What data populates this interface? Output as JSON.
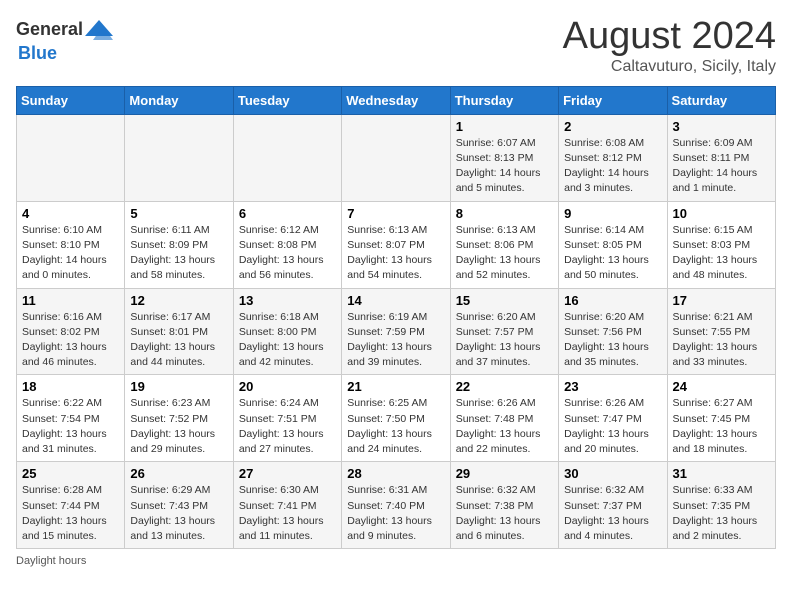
{
  "header": {
    "logo": {
      "text_general": "General",
      "text_blue": "Blue"
    },
    "title": "August 2024",
    "subtitle": "Caltavuturo, Sicily, Italy"
  },
  "calendar": {
    "days_of_week": [
      "Sunday",
      "Monday",
      "Tuesday",
      "Wednesday",
      "Thursday",
      "Friday",
      "Saturday"
    ],
    "weeks": [
      [
        {
          "day": "",
          "info": ""
        },
        {
          "day": "",
          "info": ""
        },
        {
          "day": "",
          "info": ""
        },
        {
          "day": "",
          "info": ""
        },
        {
          "day": "1",
          "info": "Sunrise: 6:07 AM\nSunset: 8:13 PM\nDaylight: 14 hours\nand 5 minutes."
        },
        {
          "day": "2",
          "info": "Sunrise: 6:08 AM\nSunset: 8:12 PM\nDaylight: 14 hours\nand 3 minutes."
        },
        {
          "day": "3",
          "info": "Sunrise: 6:09 AM\nSunset: 8:11 PM\nDaylight: 14 hours\nand 1 minute."
        }
      ],
      [
        {
          "day": "4",
          "info": "Sunrise: 6:10 AM\nSunset: 8:10 PM\nDaylight: 14 hours\nand 0 minutes."
        },
        {
          "day": "5",
          "info": "Sunrise: 6:11 AM\nSunset: 8:09 PM\nDaylight: 13 hours\nand 58 minutes."
        },
        {
          "day": "6",
          "info": "Sunrise: 6:12 AM\nSunset: 8:08 PM\nDaylight: 13 hours\nand 56 minutes."
        },
        {
          "day": "7",
          "info": "Sunrise: 6:13 AM\nSunset: 8:07 PM\nDaylight: 13 hours\nand 54 minutes."
        },
        {
          "day": "8",
          "info": "Sunrise: 6:13 AM\nSunset: 8:06 PM\nDaylight: 13 hours\nand 52 minutes."
        },
        {
          "day": "9",
          "info": "Sunrise: 6:14 AM\nSunset: 8:05 PM\nDaylight: 13 hours\nand 50 minutes."
        },
        {
          "day": "10",
          "info": "Sunrise: 6:15 AM\nSunset: 8:03 PM\nDaylight: 13 hours\nand 48 minutes."
        }
      ],
      [
        {
          "day": "11",
          "info": "Sunrise: 6:16 AM\nSunset: 8:02 PM\nDaylight: 13 hours\nand 46 minutes."
        },
        {
          "day": "12",
          "info": "Sunrise: 6:17 AM\nSunset: 8:01 PM\nDaylight: 13 hours\nand 44 minutes."
        },
        {
          "day": "13",
          "info": "Sunrise: 6:18 AM\nSunset: 8:00 PM\nDaylight: 13 hours\nand 42 minutes."
        },
        {
          "day": "14",
          "info": "Sunrise: 6:19 AM\nSunset: 7:59 PM\nDaylight: 13 hours\nand 39 minutes."
        },
        {
          "day": "15",
          "info": "Sunrise: 6:20 AM\nSunset: 7:57 PM\nDaylight: 13 hours\nand 37 minutes."
        },
        {
          "day": "16",
          "info": "Sunrise: 6:20 AM\nSunset: 7:56 PM\nDaylight: 13 hours\nand 35 minutes."
        },
        {
          "day": "17",
          "info": "Sunrise: 6:21 AM\nSunset: 7:55 PM\nDaylight: 13 hours\nand 33 minutes."
        }
      ],
      [
        {
          "day": "18",
          "info": "Sunrise: 6:22 AM\nSunset: 7:54 PM\nDaylight: 13 hours\nand 31 minutes."
        },
        {
          "day": "19",
          "info": "Sunrise: 6:23 AM\nSunset: 7:52 PM\nDaylight: 13 hours\nand 29 minutes."
        },
        {
          "day": "20",
          "info": "Sunrise: 6:24 AM\nSunset: 7:51 PM\nDaylight: 13 hours\nand 27 minutes."
        },
        {
          "day": "21",
          "info": "Sunrise: 6:25 AM\nSunset: 7:50 PM\nDaylight: 13 hours\nand 24 minutes."
        },
        {
          "day": "22",
          "info": "Sunrise: 6:26 AM\nSunset: 7:48 PM\nDaylight: 13 hours\nand 22 minutes."
        },
        {
          "day": "23",
          "info": "Sunrise: 6:26 AM\nSunset: 7:47 PM\nDaylight: 13 hours\nand 20 minutes."
        },
        {
          "day": "24",
          "info": "Sunrise: 6:27 AM\nSunset: 7:45 PM\nDaylight: 13 hours\nand 18 minutes."
        }
      ],
      [
        {
          "day": "25",
          "info": "Sunrise: 6:28 AM\nSunset: 7:44 PM\nDaylight: 13 hours\nand 15 minutes."
        },
        {
          "day": "26",
          "info": "Sunrise: 6:29 AM\nSunset: 7:43 PM\nDaylight: 13 hours\nand 13 minutes."
        },
        {
          "day": "27",
          "info": "Sunrise: 6:30 AM\nSunset: 7:41 PM\nDaylight: 13 hours\nand 11 minutes."
        },
        {
          "day": "28",
          "info": "Sunrise: 6:31 AM\nSunset: 7:40 PM\nDaylight: 13 hours\nand 9 minutes."
        },
        {
          "day": "29",
          "info": "Sunrise: 6:32 AM\nSunset: 7:38 PM\nDaylight: 13 hours\nand 6 minutes."
        },
        {
          "day": "30",
          "info": "Sunrise: 6:32 AM\nSunset: 7:37 PM\nDaylight: 13 hours\nand 4 minutes."
        },
        {
          "day": "31",
          "info": "Sunrise: 6:33 AM\nSunset: 7:35 PM\nDaylight: 13 hours\nand 2 minutes."
        }
      ]
    ]
  },
  "footer": {
    "note": "Daylight hours"
  }
}
